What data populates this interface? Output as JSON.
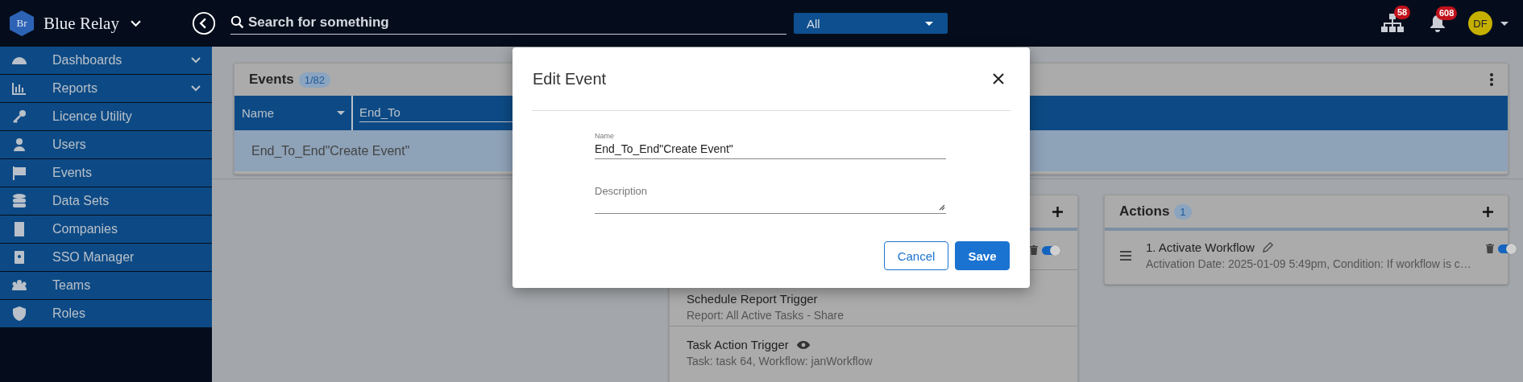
{
  "topbar": {
    "logo_text": "Br",
    "app_name": "Blue Relay",
    "search": {
      "placeholder": "Search for something"
    },
    "scope": {
      "value": "All"
    },
    "hierarchy_badge": "58",
    "notifications_badge": "608",
    "avatar": "DF"
  },
  "sidebar": {
    "items": [
      {
        "label": "Dashboards",
        "expandable": true
      },
      {
        "label": "Reports",
        "expandable": true
      },
      {
        "label": "Licence Utility",
        "expandable": false
      },
      {
        "label": "Users",
        "expandable": false
      },
      {
        "label": "Events",
        "expandable": false
      },
      {
        "label": "Data Sets",
        "expandable": false
      },
      {
        "label": "Companies",
        "expandable": false
      },
      {
        "label": "SSO Manager",
        "expandable": false
      },
      {
        "label": "Teams",
        "expandable": false
      },
      {
        "label": "Roles",
        "expandable": false
      }
    ]
  },
  "events_panel": {
    "title": "Events",
    "count": "1/82",
    "columns": [
      {
        "label": "Name"
      }
    ],
    "filter_value": "End_To",
    "rows": [
      {
        "name": "End_To_End\"Create Event\"",
        "selected": true
      }
    ]
  },
  "triggers_panel": {
    "items": [
      {
        "enabled": true
      },
      {
        "title": "Schedule Report Trigger",
        "subtitle": "Report: All Active Tasks - Share"
      },
      {
        "title": "Task Action Trigger",
        "subtitle": "Task: task 64, Workflow: janWorkflow",
        "viewable": true
      }
    ]
  },
  "actions_panel": {
    "title": "Actions",
    "count": "1",
    "items": [
      {
        "title": "1. Activate Workflow",
        "subtitle": "Activation Date: 2025-01-09 5:49pm, Condition: If workflow is c…",
        "enabled": true
      }
    ]
  },
  "modal": {
    "title": "Edit Event",
    "fields": [
      {
        "kind": "text",
        "label": "Name",
        "value": "End_To_End\"Create Event\""
      },
      {
        "kind": "textarea",
        "label": "Description"
      }
    ],
    "buttons": [
      {
        "label": "Cancel",
        "kind": "secondary"
      },
      {
        "label": "Save",
        "kind": "primary"
      }
    ]
  }
}
